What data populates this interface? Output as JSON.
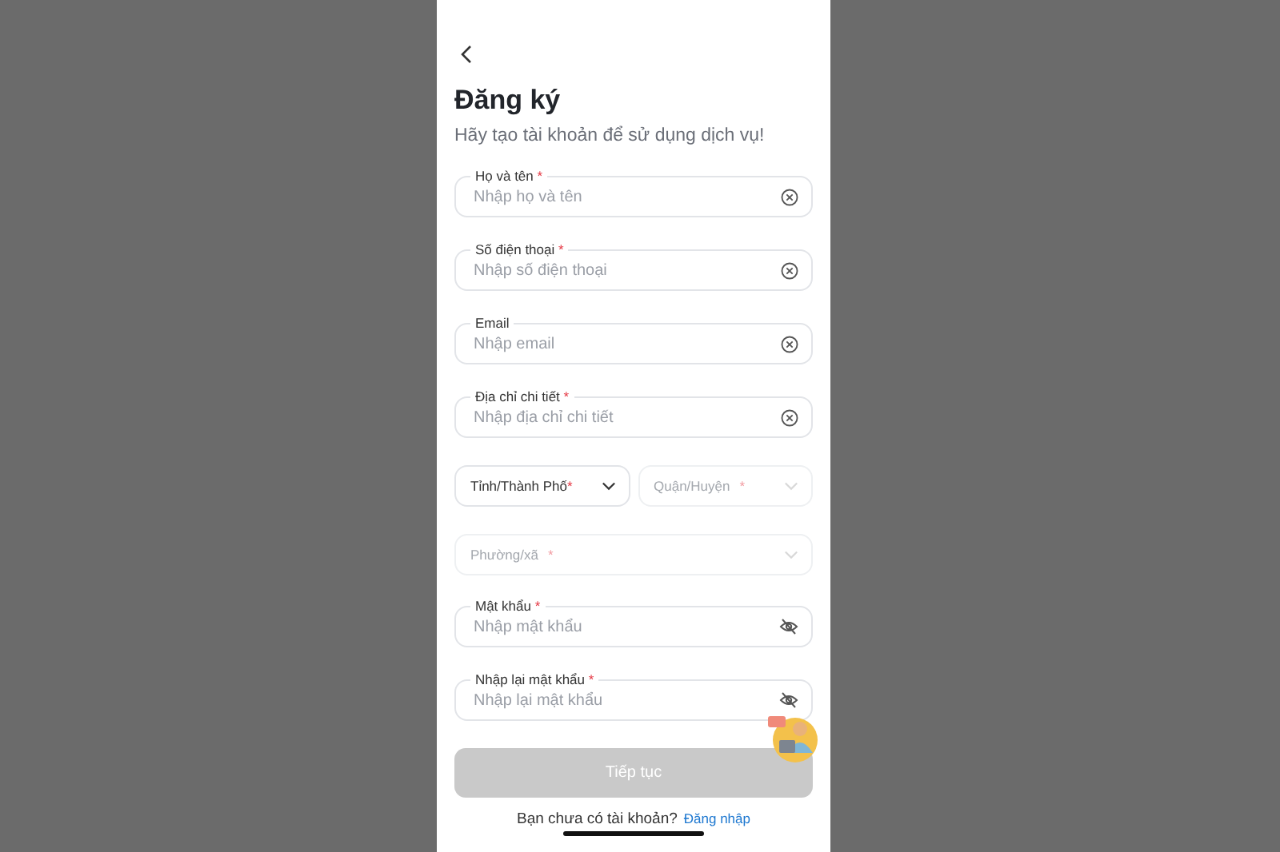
{
  "title": "Đăng ký",
  "subtitle": "Hãy tạo tài khoản để sử dụng dịch vụ!",
  "fields": [
    {
      "kind": "text",
      "label": "Họ và tên",
      "required_mark": "*",
      "placeholder": "Nhập họ và tên"
    },
    {
      "kind": "text",
      "label": "Số điện thoại",
      "required_mark": "*",
      "placeholder": "Nhập số điện thoại"
    },
    {
      "kind": "text",
      "label": "Email",
      "placeholder": "Nhập email"
    },
    {
      "kind": "text",
      "label": "Địa chỉ chi tiết",
      "required_mark": "*",
      "placeholder": "Nhập địa chỉ chi tiết"
    },
    {
      "kind": "select_row",
      "selects": [
        {
          "placeholder": "Tỉnh/Thành Phố",
          "required_mark": "*",
          "disabled": false
        },
        {
          "placeholder": "Quận/Huyện",
          "required_mark": "*",
          "disabled": true
        }
      ]
    },
    {
      "kind": "select_row",
      "selects": [
        {
          "placeholder": "Phường/xã",
          "required_mark": "*",
          "disabled": true
        }
      ]
    },
    {
      "kind": "password",
      "label": "Mật khẩu",
      "required_mark": "*",
      "placeholder": "Nhập mật khẩu"
    },
    {
      "kind": "password",
      "label": "Nhập lại mật khẩu",
      "required_mark": "*",
      "placeholder": "Nhập lại mật khẩu"
    }
  ],
  "submit": {
    "label": "Tiếp tục",
    "disabled": true
  },
  "footer": {
    "text": "Bạn chưa có tài khoản?",
    "link": "Đăng nhập"
  }
}
